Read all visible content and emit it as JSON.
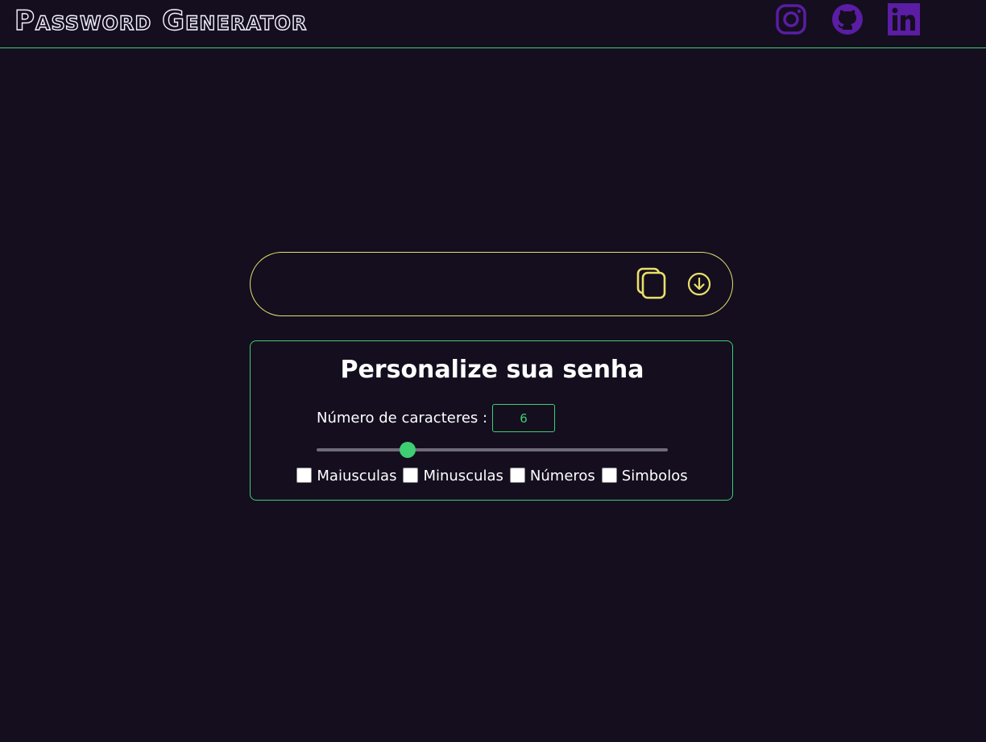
{
  "header": {
    "title": "Password Generator",
    "social": [
      {
        "icon": "instagram-icon",
        "color": "#5a1da3"
      },
      {
        "icon": "github-icon",
        "color": "#5a1da3"
      },
      {
        "icon": "linkedin-icon",
        "color": "#5a1da3"
      }
    ]
  },
  "output": {
    "value": "",
    "copy_icon": "copy-icon",
    "download_icon": "download-icon",
    "accent": "#e8e06a"
  },
  "panel": {
    "title": "Personalize sua senha",
    "length_label": "Número de caracteres :",
    "length_value": "6",
    "slider_level": 0.26,
    "accent": "#3ecf72",
    "options": [
      {
        "label": "Maiusculas",
        "checked": false
      },
      {
        "label": "Minusculas",
        "checked": false
      },
      {
        "label": "Números",
        "checked": false
      },
      {
        "label": "Simbolos",
        "checked": false
      }
    ]
  },
  "colors": {
    "background": "#140e1f",
    "header_border": "#3ecf72"
  }
}
